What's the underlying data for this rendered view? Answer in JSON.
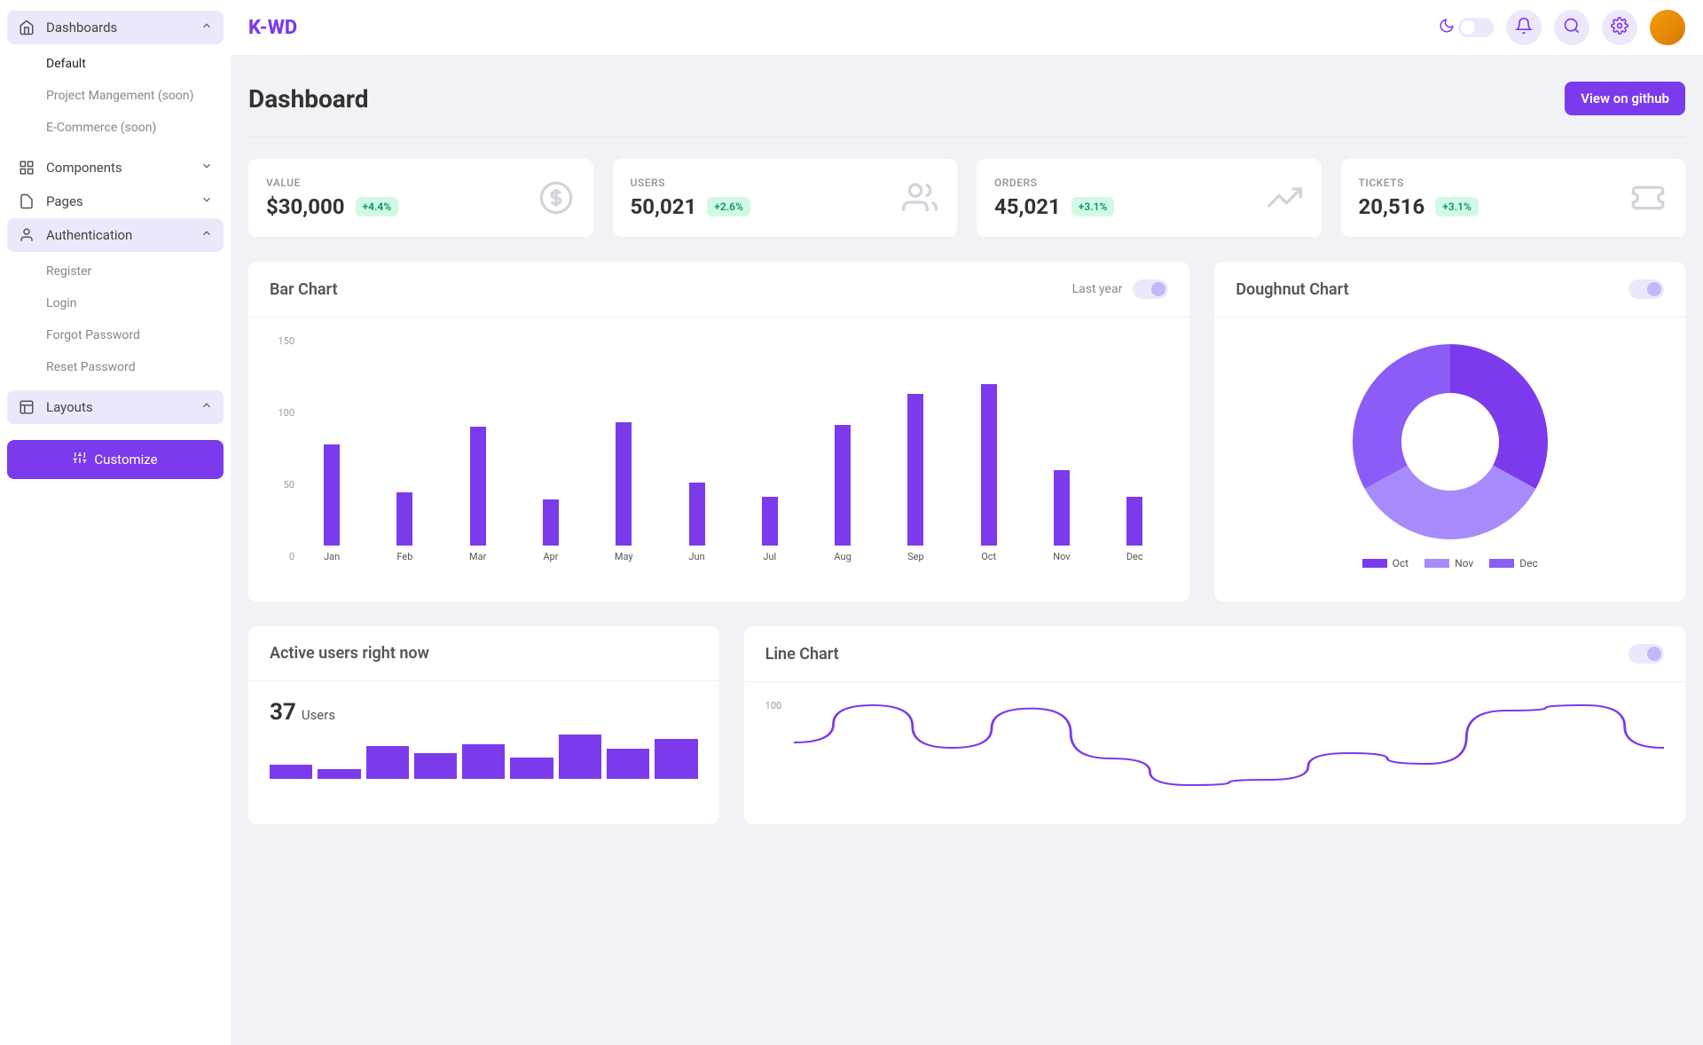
{
  "brand": "K-WD",
  "sidebar": {
    "nav": [
      {
        "label": "Dashboards",
        "expanded": true,
        "icon": "home",
        "children": [
          {
            "label": "Default",
            "active": true
          },
          {
            "label": "Project Mangement (soon)"
          },
          {
            "label": "E-Commerce (soon)"
          }
        ]
      },
      {
        "label": "Components",
        "expanded": false,
        "icon": "grid"
      },
      {
        "label": "Pages",
        "expanded": false,
        "icon": "page"
      },
      {
        "label": "Authentication",
        "expanded": true,
        "icon": "user",
        "children": [
          {
            "label": "Register"
          },
          {
            "label": "Login"
          },
          {
            "label": "Forgot Password"
          },
          {
            "label": "Reset Password"
          }
        ]
      },
      {
        "label": "Layouts",
        "expanded": true,
        "icon": "layout"
      }
    ],
    "customize_label": "Customize"
  },
  "page": {
    "title": "Dashboard",
    "github_btn": "View on github"
  },
  "stats": [
    {
      "label": "VALUE",
      "value": "$30,000",
      "delta": "+4.4%",
      "icon": "dollar"
    },
    {
      "label": "USERS",
      "value": "50,021",
      "delta": "+2.6%",
      "icon": "users"
    },
    {
      "label": "ORDERS",
      "value": "45,021",
      "delta": "+3.1%",
      "icon": "trend"
    },
    {
      "label": "TICKETS",
      "value": "20,516",
      "delta": "+3.1%",
      "icon": "ticket"
    }
  ],
  "bar_chart": {
    "title": "Bar Chart",
    "period_label": "Last year"
  },
  "doughnut_chart": {
    "title": "Doughnut Chart"
  },
  "active_users": {
    "title": "Active users right now",
    "count": "37",
    "unit": "Users"
  },
  "line_chart": {
    "title": "Line Chart"
  },
  "colors": {
    "primary": "#7c3aed",
    "primary_light": "#a78bfa",
    "primary_mid": "#8b5cf6"
  },
  "chart_data": [
    {
      "id": "bar_chart",
      "type": "bar",
      "title": "Bar Chart",
      "ylabel": "",
      "ylim": [
        0,
        150
      ],
      "yticks": [
        0,
        50,
        100,
        150
      ],
      "categories": [
        "Jan",
        "Feb",
        "Mar",
        "Apr",
        "May",
        "Jun",
        "Jul",
        "Aug",
        "Sep",
        "Oct",
        "Nov",
        "Dec"
      ],
      "values": [
        72,
        38,
        85,
        33,
        88,
        45,
        35,
        86,
        108,
        115,
        54,
        35
      ]
    },
    {
      "id": "doughnut_chart",
      "type": "pie",
      "title": "Doughnut Chart",
      "series": [
        {
          "name": "Oct",
          "value": 33,
          "color": "#7c3aed"
        },
        {
          "name": "Nov",
          "value": 34,
          "color": "#a78bfa"
        },
        {
          "name": "Dec",
          "value": 33,
          "color": "#8b5cf6"
        }
      ]
    },
    {
      "id": "active_users_spark",
      "type": "bar",
      "title": "Active users right now",
      "values": [
        12,
        8,
        28,
        22,
        30,
        18,
        38,
        26,
        34
      ]
    },
    {
      "id": "line_chart",
      "type": "line",
      "title": "Line Chart",
      "ylim": [
        0,
        100
      ],
      "yticks": [
        100
      ],
      "x": [
        0,
        1,
        2,
        3,
        4,
        5,
        6,
        7,
        8,
        9,
        10,
        11
      ],
      "values": [
        60,
        95,
        55,
        92,
        45,
        20,
        25,
        50,
        40,
        90,
        95,
        55
      ]
    }
  ]
}
